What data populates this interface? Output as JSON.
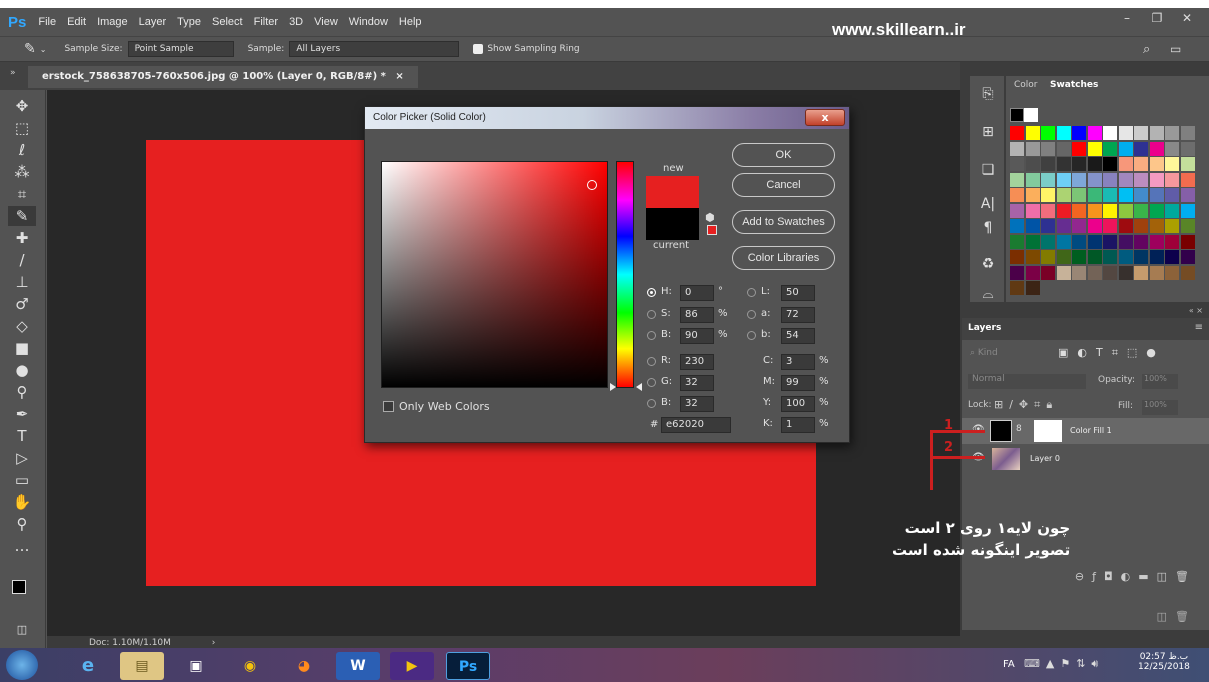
{
  "menubar": {
    "logo": "Ps",
    "items": [
      "File",
      "Edit",
      "Image",
      "Layer",
      "Type",
      "Select",
      "Filter",
      "3D",
      "View",
      "Window",
      "Help"
    ],
    "watermark": "www.skillearn..ir"
  },
  "options": {
    "sample_size_label": "Sample Size:",
    "sample_size_value": "Point Sample",
    "sample_label": "Sample:",
    "sample_value": "All Layers",
    "show_ring": "Show Sampling Ring"
  },
  "document": {
    "tab_title": "erstock_758638705-760x506.jpg @ 100% (Layer 0, RGB/8#) *",
    "tab_close": "×",
    "doc_size": "Doc: 1.10M/1.10M"
  },
  "dialog": {
    "title": "Color Picker (Solid Color)",
    "close": "x",
    "new_label": "new",
    "current_label": "current",
    "new_color": "#e62020",
    "current_color": "#000000",
    "buttons": {
      "ok": "OK",
      "cancel": "Cancel",
      "add": "Add to Swatches",
      "libraries": "Color Libraries"
    },
    "fields": {
      "H": "0",
      "S": "86",
      "B": "90",
      "R": "230",
      "G": "32",
      "B2": "32",
      "L": "50",
      "a": "72",
      "b": "54",
      "C": "3",
      "M": "99",
      "Y": "100",
      "K": "1"
    },
    "labels": {
      "H": "H:",
      "S": "S:",
      "B": "B:",
      "R": "R:",
      "G": "G:",
      "Bb": "B:",
      "L": "L:",
      "a": "a:",
      "b": "b:",
      "C": "C:",
      "M": "M:",
      "Y": "Y:",
      "K": "K:"
    },
    "units": {
      "deg": "°",
      "pct": "%"
    },
    "hex_label": "#",
    "hex": "e62020",
    "web_only": "Only Web Colors"
  },
  "panels": {
    "color_tab": "Color",
    "swatches_tab": "Swatches",
    "layers_title": "Layers",
    "kind": "Kind",
    "blend_mode": "Normal",
    "opacity_label": "Opacity:",
    "opacity_value": "100%",
    "lock_label": "Lock:",
    "fill_label": "Fill:",
    "fill_value": "100%",
    "layers": [
      {
        "name": "Color Fill 1"
      },
      {
        "name": "Layer 0"
      }
    ]
  },
  "annotation": {
    "num1": "1",
    "num2": "2",
    "line1": "چون لایه۱ روی ۲ است",
    "line2": "تصویر اینگونه شده است"
  },
  "taskbar": {
    "lang": "FA",
    "time": "02:57 ب.ظ",
    "date": "12/25/2018"
  }
}
